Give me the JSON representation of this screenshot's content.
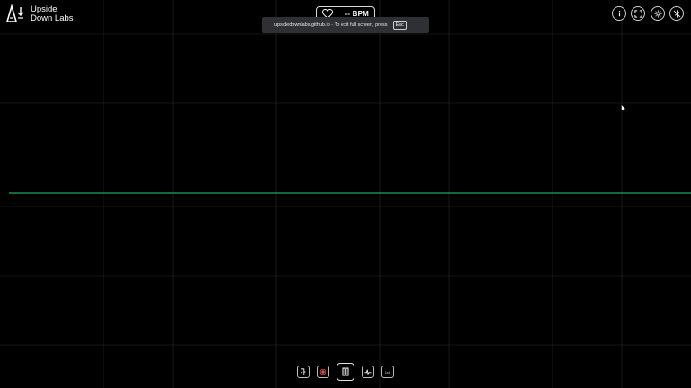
{
  "app": {
    "brand_line1": "Upside",
    "brand_line2": "Down Labs"
  },
  "bpm": {
    "value": "-- BPM"
  },
  "toast": {
    "message": "upsidedownlabs.github.io - To exit full screen, press",
    "key": "Esc"
  },
  "toolbar_top": [
    "info-icon",
    "fullscreen-icon",
    "settings-icon",
    "bluetooth-icon"
  ],
  "toolbar_bottom": {
    "items": [
      "connect-icon",
      "record-icon",
      "pause-icon",
      "filter-icon",
      "channel-count"
    ],
    "channel_label": "1ch"
  },
  "colors": {
    "background": "#000000",
    "grid": "#2a2a2a",
    "signal": "#1f8a4c",
    "accent": "#ffffff"
  },
  "signal": {
    "values": [
      0,
      0,
      0,
      0,
      0,
      0,
      0,
      0,
      0,
      0,
      0,
      0
    ]
  }
}
